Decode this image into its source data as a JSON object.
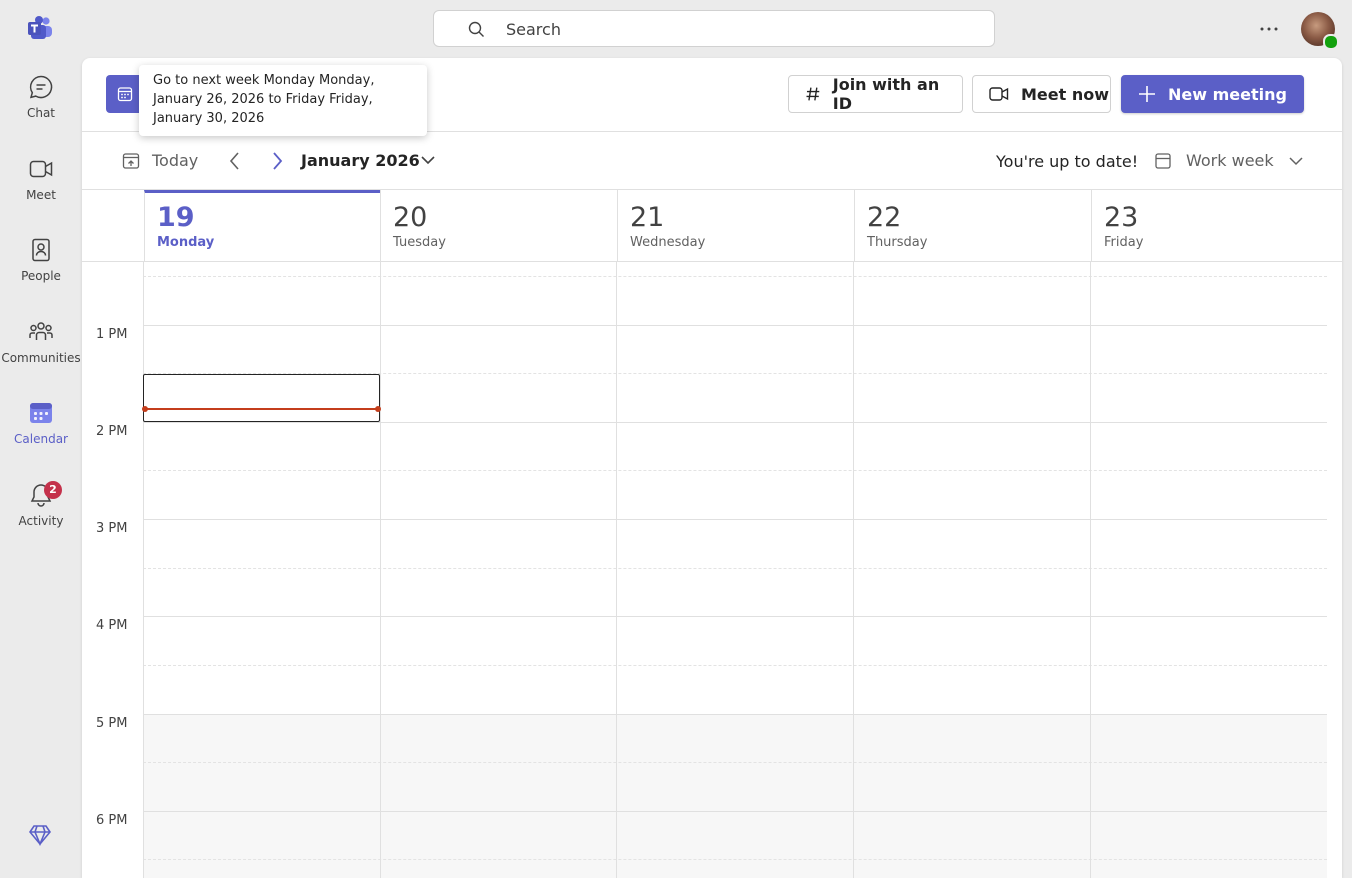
{
  "rail": {
    "items": [
      {
        "label": "Chat",
        "icon": "chat-icon"
      },
      {
        "label": "Meet",
        "icon": "video-icon"
      },
      {
        "label": "People",
        "icon": "people-icon"
      },
      {
        "label": "Communities",
        "icon": "communities-icon"
      },
      {
        "label": "Calendar",
        "icon": "calendar-icon",
        "active": true
      },
      {
        "label": "Activity",
        "icon": "bell-icon",
        "badge": "2"
      }
    ]
  },
  "search": {
    "placeholder": "Search"
  },
  "header": {
    "join_label": "Join with an ID",
    "meet_now_label": "Meet now",
    "new_meeting_label": "New meeting"
  },
  "tooltip": {
    "text": "Go to next week Monday Monday, January 26, 2026 to Friday Friday, January 30, 2026"
  },
  "toolbar": {
    "today_label": "Today",
    "month_label": "January 2026",
    "status_text": "You're up to date!",
    "view_label": "Work week"
  },
  "days": [
    {
      "num": "19",
      "name": "Monday"
    },
    {
      "num": "20",
      "name": "Tuesday"
    },
    {
      "num": "21",
      "name": "Wednesday"
    },
    {
      "num": "22",
      "name": "Thursday"
    },
    {
      "num": "23",
      "name": "Friday"
    }
  ],
  "time_labels": [
    "1 PM",
    "2 PM",
    "3 PM",
    "4 PM",
    "5 PM",
    "6 PM"
  ],
  "colors": {
    "accent": "#5b5fc7",
    "now_line": "#c43e1c",
    "badge": "#c4314b"
  }
}
